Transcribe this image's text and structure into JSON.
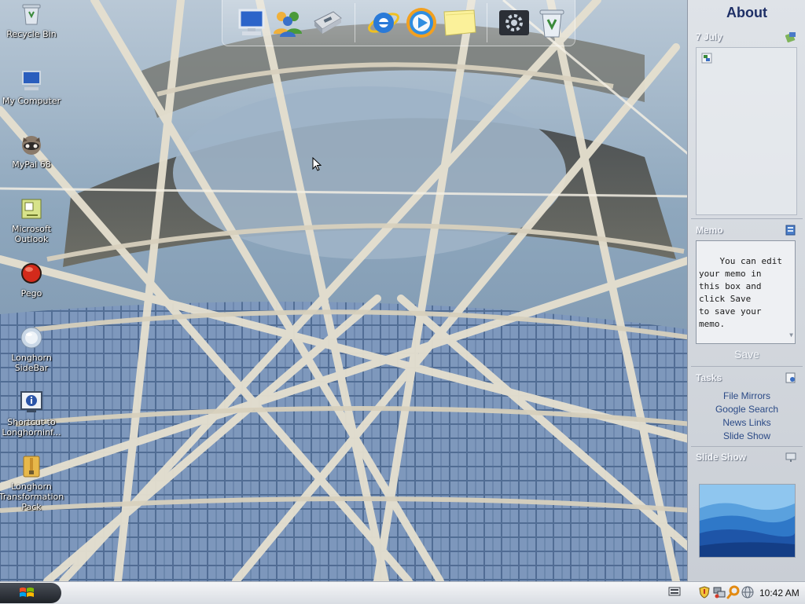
{
  "desktop": {
    "icons": [
      {
        "label": "Recycle Bin",
        "icon": "recycle-bin-icon"
      },
      {
        "label": "My Computer",
        "icon": "computer-icon"
      },
      {
        "label": "MyPal 68",
        "icon": "raccoon-browser-icon"
      },
      {
        "label": "Microsoft Outlook",
        "icon": "outlook-icon"
      },
      {
        "label": "Pego",
        "icon": "red-orb-icon"
      },
      {
        "label": "Longhorn SideBar",
        "icon": "sidebar-orb-icon"
      },
      {
        "label": "Shortcut to Longhorninf...",
        "icon": "info-shortcut-icon"
      },
      {
        "label": "Longhorn Transformation Pack",
        "icon": "folder-zip-icon"
      }
    ]
  },
  "dock": {
    "items": [
      "computer-icon",
      "users-icon",
      "scanner-icon",
      "internet-explorer-icon",
      "media-player-icon",
      "sticky-note-icon",
      "settings-icon",
      "recycle-bin-icon"
    ]
  },
  "sidebar": {
    "title": "About",
    "calendar": {
      "date": "7 July"
    },
    "memo": {
      "heading": "Memo",
      "text": "You can edit\nyour memo in\nthis box and\nclick Save\nto save your\nmemo.",
      "save_label": "Save"
    },
    "tasks": {
      "heading": "Tasks",
      "links": [
        "File Mirrors",
        "Google Search",
        "News Links",
        "Slide Show"
      ]
    },
    "slideshow": {
      "heading": "Slide Show"
    }
  },
  "taskbar": {
    "clock": "10:42 AM",
    "tray_icons": [
      "keyboard-icon",
      "shield-icon",
      "network-icon",
      "search-icon",
      "globe-icon"
    ]
  },
  "colors": {
    "sidebar_title": "#1e2f66",
    "task_link": "#2b4a86"
  }
}
